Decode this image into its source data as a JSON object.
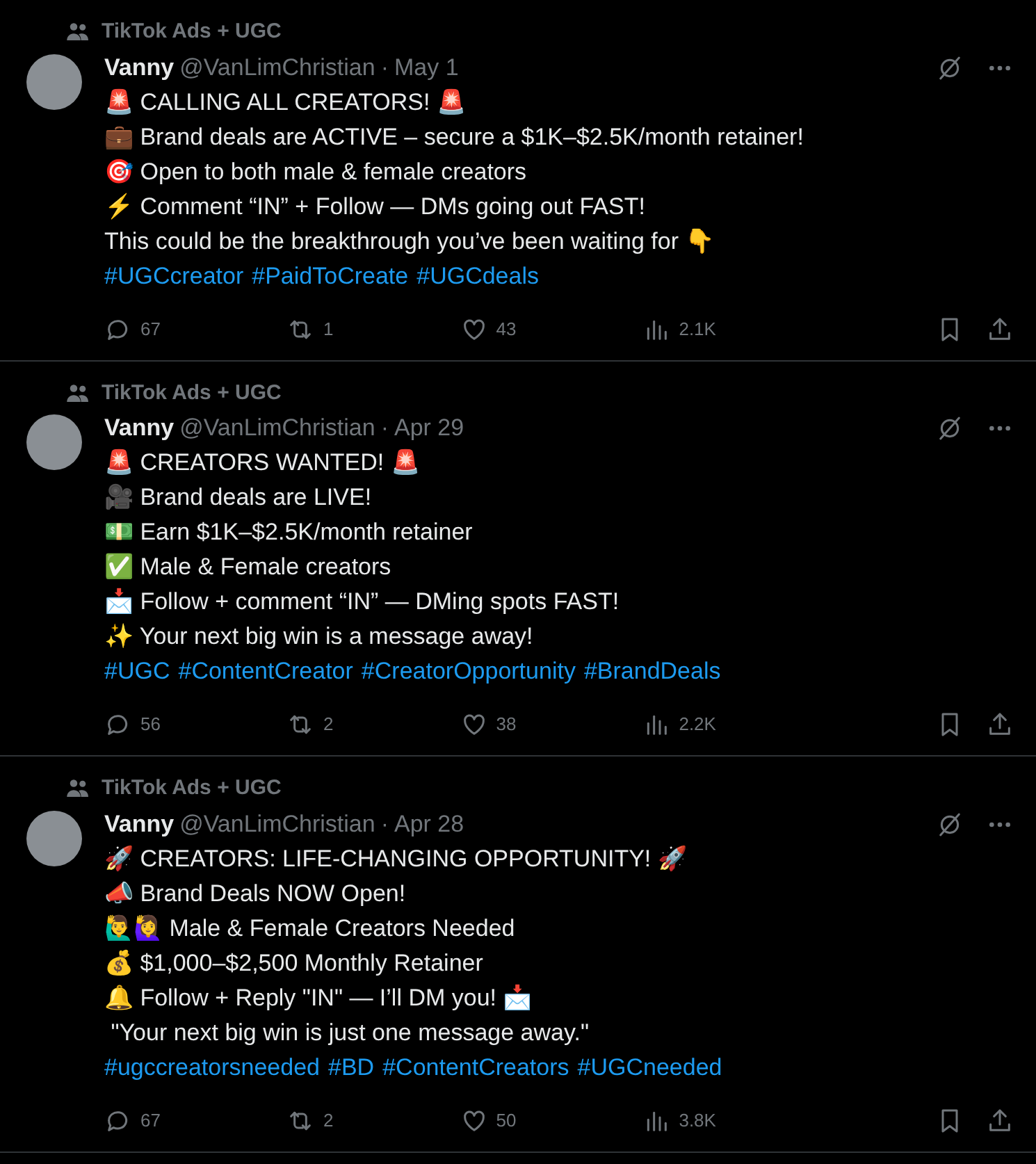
{
  "tweets": [
    {
      "context": "TikTok Ads + UGC",
      "name": "Vanny",
      "handle": "@VanLimChristian",
      "separator": "·",
      "date": "May 1",
      "lines": [
        "🚨 CALLING ALL CREATORS! 🚨",
        "💼 Brand deals are ACTIVE – secure a $1K–$2.5K/month retainer!",
        "🎯 Open to both male & female creators",
        "⚡ Comment “IN” + Follow — DMs going out FAST!",
        "This could be the breakthrough you’ve been waiting for 👇"
      ],
      "hashtags": [
        "#UGCcreator",
        "#PaidToCreate",
        "#UGCdeals"
      ],
      "replies": "67",
      "reposts": "1",
      "likes": "43",
      "views": "2.1K"
    },
    {
      "context": "TikTok Ads + UGC",
      "name": "Vanny",
      "handle": "@VanLimChristian",
      "separator": "·",
      "date": "Apr 29",
      "lines": [
        "🚨 CREATORS WANTED! 🚨",
        "🎥 Brand deals are LIVE!",
        "💵 Earn $1K–$2.5K/month retainer",
        "✅ Male & Female creators",
        "📩 Follow + comment “IN” — DMing spots FAST!",
        "✨ Your next big win is a message away!"
      ],
      "hashtags": [
        "#UGC",
        "#ContentCreator",
        "#CreatorOpportunity",
        "#BrandDeals"
      ],
      "replies": "56",
      "reposts": "2",
      "likes": "38",
      "views": "2.2K"
    },
    {
      "context": "TikTok Ads + UGC",
      "name": "Vanny",
      "handle": "@VanLimChristian",
      "separator": "·",
      "date": "Apr 28",
      "lines": [
        "🚀 CREATORS: LIFE-CHANGING OPPORTUNITY! 🚀",
        "📣 Brand Deals NOW Open!",
        "🙋‍♂️🙋‍♀️ Male & Female Creators Needed",
        "💰 $1,000–$2,500 Monthly Retainer",
        "🔔 Follow + Reply \"IN\" — I’ll DM you! 📩",
        " \"Your next big win is just one message away.\""
      ],
      "hashtags": [
        "#ugccreatorsneeded",
        "#BD",
        "#ContentCreators",
        "#UGCneeded"
      ],
      "replies": "67",
      "reposts": "2",
      "likes": "50",
      "views": "3.8K"
    }
  ]
}
